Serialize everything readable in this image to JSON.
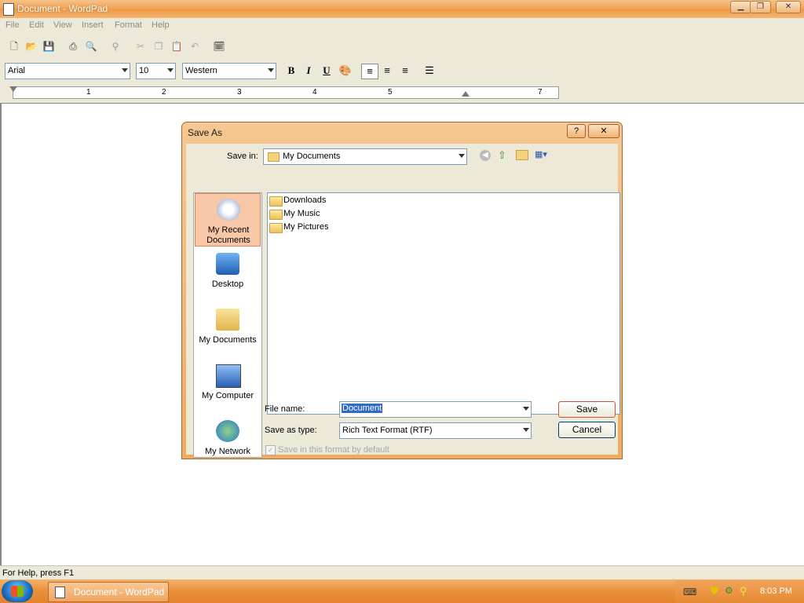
{
  "window": {
    "title": "Document - WordPad",
    "minimize": "▁",
    "restore": "❐",
    "close": "✕"
  },
  "menu": [
    "File",
    "Edit",
    "View",
    "Insert",
    "Format",
    "Help"
  ],
  "toolbar": {
    "font": "Arial",
    "size": "10",
    "script": "Western",
    "bold": "B",
    "italic": "I",
    "underline": "U"
  },
  "ruler": {
    "ticks": [
      "1",
      "2",
      "3",
      "4",
      "5",
      "7"
    ]
  },
  "statusbar": {
    "text": "For Help, press F1"
  },
  "taskbar": {
    "task_label": "Document - WordPad",
    "clock": "8:03 PM"
  },
  "dialog": {
    "title": "Save As",
    "help": "?",
    "close": "✕",
    "save_in_label": "Save in:",
    "save_in_value": "My Documents",
    "places": [
      {
        "label": "My Recent Documents",
        "icon": "recent-documents-icon"
      },
      {
        "label": "Desktop",
        "icon": "desktop-icon"
      },
      {
        "label": "My Documents",
        "icon": "my-documents-icon"
      },
      {
        "label": "My Computer",
        "icon": "my-computer-icon"
      },
      {
        "label": "My Network",
        "icon": "my-network-icon"
      }
    ],
    "files": [
      "Downloads",
      "My Music",
      "My Pictures"
    ],
    "file_name_label": "File name:",
    "file_name_value": "Document",
    "save_type_label": "Save as type:",
    "save_type_value": "Rich Text Format (RTF)",
    "save_button": "Save",
    "cancel_button": "Cancel",
    "default_checkbox_label": "Save in this format by default",
    "default_checkbox_checked": true
  }
}
